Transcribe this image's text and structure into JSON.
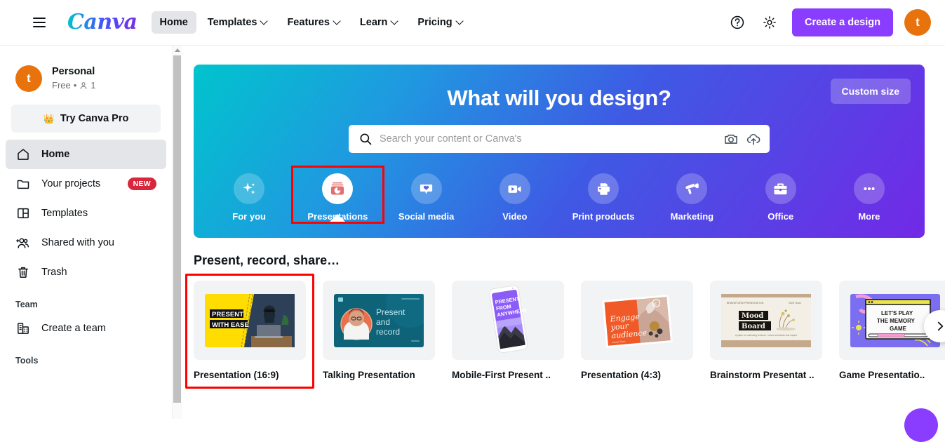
{
  "header": {
    "menu_icon": "hamburger-icon",
    "logo_text": "Canva",
    "nav": [
      {
        "label": "Home",
        "has_chevron": false,
        "active": true
      },
      {
        "label": "Templates",
        "has_chevron": true,
        "active": false
      },
      {
        "label": "Features",
        "has_chevron": true,
        "active": false
      },
      {
        "label": "Learn",
        "has_chevron": true,
        "active": false
      },
      {
        "label": "Pricing",
        "has_chevron": true,
        "active": false
      }
    ],
    "help_icon": "help-circle-icon",
    "settings_icon": "gear-icon",
    "cta_label": "Create a design",
    "cta_color": "#8b3dff",
    "avatar_initial": "t",
    "avatar_color": "#e8720c"
  },
  "sidebar": {
    "profile": {
      "avatar_initial": "t",
      "name": "Personal",
      "plan": "Free",
      "separator": "•",
      "member_count": "1"
    },
    "pro_button": {
      "label": "Try Canva Pro",
      "icon": "crown-icon"
    },
    "items": [
      {
        "label": "Home",
        "icon": "home-icon",
        "active": true,
        "badge": ""
      },
      {
        "label": "Your projects",
        "icon": "folder-icon",
        "active": false,
        "badge": "NEW"
      },
      {
        "label": "Templates",
        "icon": "templates-icon",
        "active": false,
        "badge": ""
      },
      {
        "label": "Shared with you",
        "icon": "shared-users-icon",
        "active": false,
        "badge": ""
      },
      {
        "label": "Trash",
        "icon": "trash-icon",
        "active": false,
        "badge": ""
      }
    ],
    "team_section_label": "Team",
    "team_item": {
      "label": "Create a team",
      "icon": "building-icon"
    },
    "tools_section_label": "Tools",
    "badge_color": "#d8273c"
  },
  "hero": {
    "title": "What will you design?",
    "custom_size_label": "Custom size",
    "search": {
      "placeholder": "Search your content or Canva's",
      "value": "",
      "search_icon": "search-icon",
      "camera_icon": "camera-icon",
      "upload_icon": "cloud-upload-icon"
    },
    "gradient_start": "#00c4cc",
    "gradient_end": "#7229e6",
    "categories": [
      {
        "label": "For you",
        "icon": "sparkles-icon",
        "selected": false
      },
      {
        "label": "Presentations",
        "icon": "presentation-board-icon",
        "selected": true
      },
      {
        "label": "Social media",
        "icon": "heart-bubble-icon",
        "selected": false
      },
      {
        "label": "Video",
        "icon": "video-camera-icon",
        "selected": false
      },
      {
        "label": "Print products",
        "icon": "printer-icon",
        "selected": false
      },
      {
        "label": "Marketing",
        "icon": "megaphone-icon",
        "selected": false
      },
      {
        "label": "Office",
        "icon": "briefcase-icon",
        "selected": false
      },
      {
        "label": "More",
        "icon": "ellipsis-icon",
        "selected": false
      }
    ]
  },
  "main": {
    "section_heading": "Present, record, share…",
    "cards": [
      {
        "label": "Presentation (16:9)",
        "selected": true,
        "thumb": "present-with-ease-yellow",
        "thumb_text": "PRESENT WITH EASE"
      },
      {
        "label": "Talking Presentation",
        "selected": false,
        "thumb": "present-and-record-teal",
        "thumb_text": "Present and record"
      },
      {
        "label": "Mobile-First Present ..",
        "selected": false,
        "thumb": "present-from-anywhere-phone",
        "thumb_text": "PRESENT FROM ANYWHERE"
      },
      {
        "label": "Presentation (4:3)",
        "selected": false,
        "thumb": "engage-your-audience-orange",
        "thumb_text": "Engage your audience"
      },
      {
        "label": "Brainstorm Presentat ..",
        "selected": false,
        "thumb": "mood-board-cream",
        "thumb_text": "Mood Board"
      },
      {
        "label": "Game Presentatio..",
        "selected": false,
        "thumb": "memory-game-purple",
        "thumb_text": "LET'S PLAY THE MEMORY GAME"
      }
    ],
    "next_arrow_icon": "chevron-right-icon"
  },
  "fab": {
    "icon": "help-bubble-icon",
    "color": "#8b3dff"
  }
}
